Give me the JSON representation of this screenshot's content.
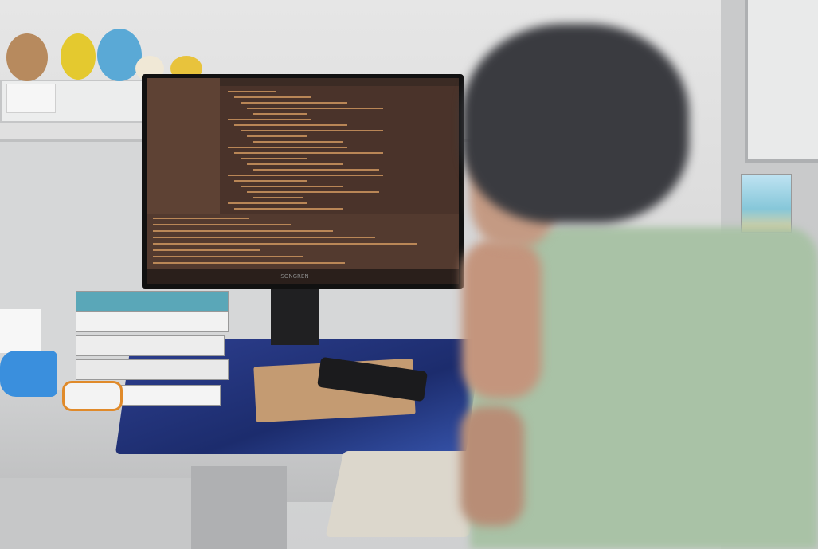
{
  "scene": {
    "description_objects": [
      "wall",
      "monitor",
      "books",
      "desk",
      "keyboard",
      "phone",
      "person"
    ],
    "monitor_brand_text": "SONGREN"
  }
}
